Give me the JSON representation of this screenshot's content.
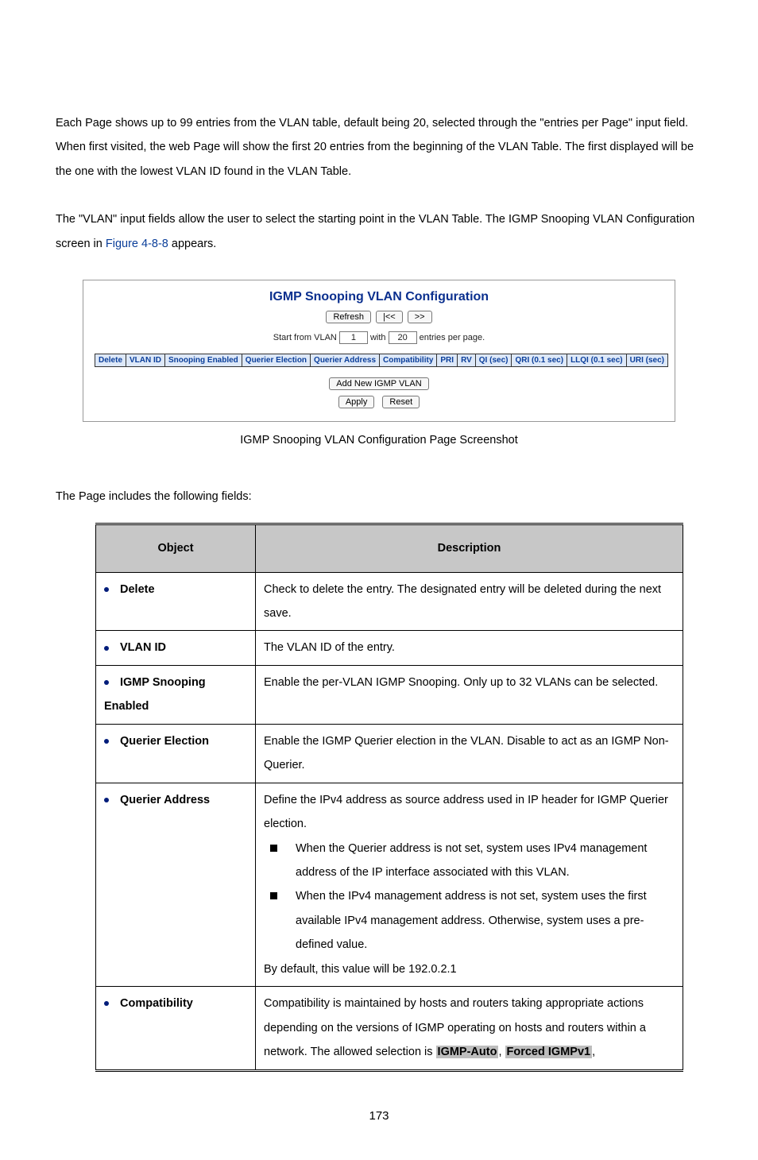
{
  "paragraphs": {
    "p1": "Each Page shows up to 99 entries from the VLAN table, default being 20, selected through the \"entries per Page\" input field. When first visited, the web Page will show the first 20 entries from the beginning of the VLAN Table. The first displayed will be the one with the lowest VLAN ID found in the VLAN Table.",
    "p2a": "The \"VLAN\" input fields allow the user to select the starting point in the VLAN Table. The IGMP Snooping VLAN Configuration screen in ",
    "p2_fig": "Figure 4-8-8",
    "p2b": " appears."
  },
  "shot": {
    "title": "IGMP Snooping VLAN Configuration",
    "refresh": "Refresh",
    "prev": "|<<",
    "next": ">>",
    "start_prefix": "Start from VLAN",
    "start_value": "1",
    "with_prefix": "with",
    "with_value": "20",
    "with_suffix": "entries per page.",
    "headers": [
      "Delete",
      "VLAN ID",
      "Snooping Enabled",
      "Querier Election",
      "Querier Address",
      "Compatibility",
      "PRI",
      "RV",
      "QI (sec)",
      "QRI (0.1 sec)",
      "LLQI (0.1 sec)",
      "URI (sec)"
    ],
    "add_btn": "Add New IGMP VLAN",
    "apply_btn": "Apply",
    "reset_btn": "Reset"
  },
  "caption": "IGMP Snooping VLAN Configuration Page Screenshot",
  "fields_intro": "The Page includes the following fields:",
  "fields_header": {
    "object": "Object",
    "description": "Description"
  },
  "rows": [
    {
      "object": "Delete",
      "desc": "Check to delete the entry. The designated entry will be deleted during the next save."
    },
    {
      "object": "VLAN ID",
      "desc": "The VLAN ID of the entry."
    },
    {
      "object": "IGMP Snooping Enabled",
      "desc": "Enable the per-VLAN IGMP Snooping. Only up to 32 VLANs can be selected."
    },
    {
      "object": "Querier Election",
      "desc": "Enable the IGMP Querier election in the VLAN. Disable to act as an IGMP Non-Querier."
    }
  ],
  "row5": {
    "object": "Querier Address",
    "desc_intro": "Define the IPv4 address as source address used in IP header for IGMP Querier election.",
    "bullets": [
      "When the Querier address is not set, system uses IPv4 management address of the IP interface associated with this VLAN.",
      "When the IPv4 management address is not set, system uses the first available IPv4 management address. Otherwise, system uses a pre-defined value."
    ],
    "desc_outro": "By default, this value will be 192.0.2.1"
  },
  "row6": {
    "object": "Compatibility",
    "desc_a": "Compatibility is maintained by hosts and routers taking appropriate actions depending on the versions of IGMP operating on hosts and routers within a network. The allowed selection is ",
    "opt1": "IGMP-Auto",
    "sep1": ", ",
    "opt2": "Forced IGMPv1",
    "sep2": ", "
  },
  "page_number": "173"
}
